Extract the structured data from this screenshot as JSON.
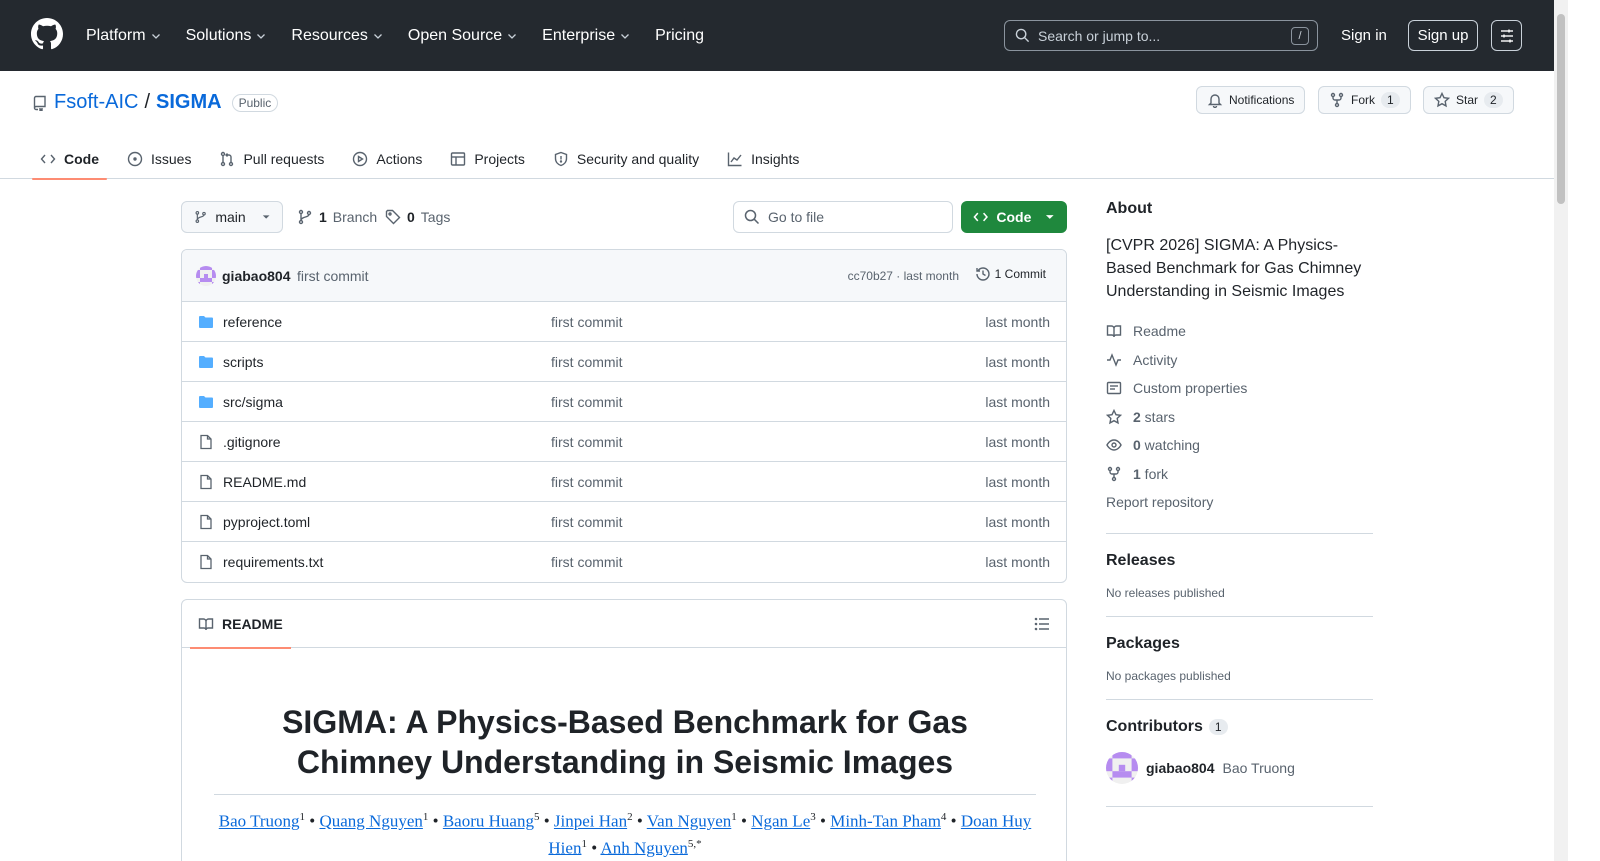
{
  "nav": {
    "items": [
      {
        "label": "Platform",
        "dropdown": true
      },
      {
        "label": "Solutions",
        "dropdown": true
      },
      {
        "label": "Resources",
        "dropdown": true
      },
      {
        "label": "Open Source",
        "dropdown": true
      },
      {
        "label": "Enterprise",
        "dropdown": true
      },
      {
        "label": "Pricing",
        "dropdown": false
      }
    ],
    "search_placeholder": "Search or jump to...",
    "search_key": "/",
    "signin": "Sign in",
    "signup": "Sign up"
  },
  "repo": {
    "owner": "Fsoft-AIC",
    "separator": "/",
    "name": "SIGMA",
    "visibility": "Public",
    "notifications": "Notifications",
    "fork_label": "Fork",
    "fork_count": "1",
    "star_label": "Star",
    "star_count": "2"
  },
  "tabs": [
    {
      "label": "Code",
      "icon": "code-icon"
    },
    {
      "label": "Issues",
      "icon": "issue-icon"
    },
    {
      "label": "Pull requests",
      "icon": "pull-request-icon"
    },
    {
      "label": "Actions",
      "icon": "play-icon"
    },
    {
      "label": "Projects",
      "icon": "table-icon"
    },
    {
      "label": "Security and quality",
      "icon": "shield-icon"
    },
    {
      "label": "Insights",
      "icon": "graph-icon"
    }
  ],
  "toolbar": {
    "branch": "main",
    "branch_count": "1",
    "branch_label": "Branch",
    "tag_count": "0",
    "tag_label": "Tags",
    "goto_placeholder": "Go to file",
    "code_button": "Code"
  },
  "commit": {
    "author": "giabao804",
    "message": "first commit",
    "hash_time": "cc70b27 · last month",
    "count": "1 Commit"
  },
  "files": [
    {
      "name": "reference",
      "type": "folder",
      "message": "first commit",
      "time": "last month"
    },
    {
      "name": "scripts",
      "type": "folder",
      "message": "first commit",
      "time": "last month"
    },
    {
      "name": "src/sigma",
      "type": "folder",
      "message": "first commit",
      "time": "last month"
    },
    {
      "name": ".gitignore",
      "type": "file",
      "message": "first commit",
      "time": "last month"
    },
    {
      "name": "README.md",
      "type": "file",
      "message": "first commit",
      "time": "last month"
    },
    {
      "name": "pyproject.toml",
      "type": "file",
      "message": "first commit",
      "time": "last month"
    },
    {
      "name": "requirements.txt",
      "type": "file",
      "message": "first commit",
      "time": "last month"
    }
  ],
  "readme": {
    "tab_label": "README",
    "title": "SIGMA: A Physics-Based Benchmark for Gas Chimney Understanding in Seismic Images",
    "authors": [
      {
        "name": "Bao Truong",
        "sup": "1"
      },
      {
        "name": "Quang Nguyen",
        "sup": "1"
      },
      {
        "name": "Baoru Huang",
        "sup": "5"
      },
      {
        "name": "Jinpei Han",
        "sup": "2"
      },
      {
        "name": "Van Nguyen",
        "sup": "1"
      },
      {
        "name": "Ngan Le",
        "sup": "3"
      },
      {
        "name": "Minh-Tan Pham",
        "sup": "4"
      },
      {
        "name": "Doan Huy Hien",
        "sup": "1"
      },
      {
        "name": "Anh Nguyen",
        "sup": "5,*"
      }
    ],
    "separator": " • "
  },
  "sidebar": {
    "about_title": "About",
    "description": "[CVPR 2026] SIGMA: A Physics-Based Benchmark for Gas Chimney Understanding in Seismic Images",
    "items": [
      {
        "icon": "book-icon",
        "bold": "",
        "label": "Readme"
      },
      {
        "icon": "pulse-icon",
        "bold": "",
        "label": "Activity"
      },
      {
        "icon": "note-icon",
        "bold": "",
        "label": "Custom properties"
      },
      {
        "icon": "star-icon",
        "bold": "2",
        "label": " stars"
      },
      {
        "icon": "eye-icon",
        "bold": "0",
        "label": " watching"
      },
      {
        "icon": "fork-icon",
        "bold": "1",
        "label": " fork"
      }
    ],
    "report": "Report repository",
    "releases_title": "Releases",
    "releases_sub": "No releases published",
    "packages_title": "Packages",
    "packages_sub": "No packages published",
    "contributors_title": "Contributors",
    "contributors_count": "1",
    "contributor_login": "giabao804",
    "contributor_name": "Bao Truong"
  },
  "colors": {
    "header_bg": "#24292f",
    "link": "#0969da",
    "code_button": "#1f883d",
    "tab_underline": "#fd8c73",
    "folder": "#54aeff",
    "avatar": "#b68cf0"
  }
}
